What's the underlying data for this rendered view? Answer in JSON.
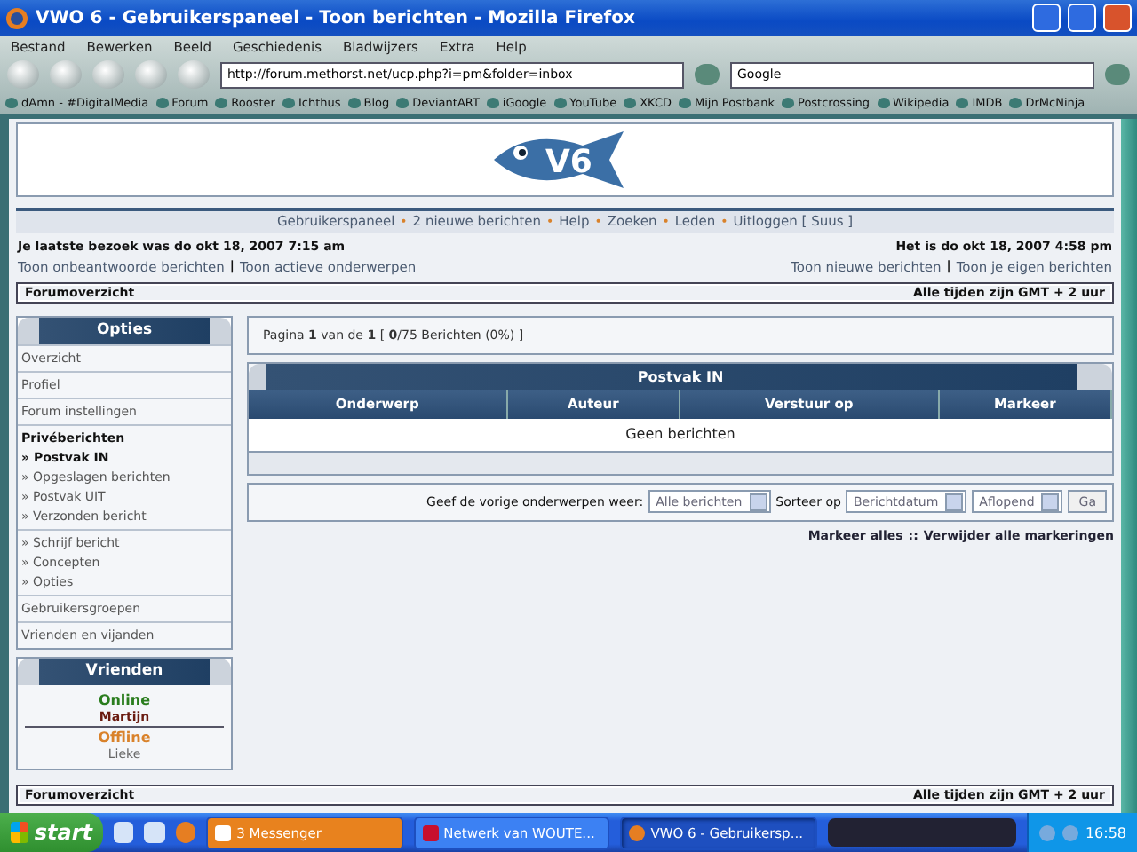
{
  "window": {
    "title": "VWO 6 - Gebruikerspaneel - Toon berichten - Mozilla Firefox"
  },
  "menu": [
    "Bestand",
    "Bewerken",
    "Beeld",
    "Geschiedenis",
    "Bladwijzers",
    "Extra",
    "Help"
  ],
  "toolbar": {
    "address": "http://forum.methorst.net/ucp.php?i=pm&folder=inbox",
    "search": "Google"
  },
  "bookmarks": [
    "dAmn - #DigitalMedia",
    "Forum",
    "Rooster",
    "Ichthus",
    "Blog",
    "DeviantART",
    "iGoogle",
    "YouTube",
    "XKCD",
    "Mijn Postbank",
    "Postcrossing",
    "Wikipedia",
    "IMDB",
    "DrMcNinja"
  ],
  "forum": {
    "logo_text": "V6",
    "nav": {
      "separator": "•",
      "links": [
        "Gebruikerspaneel",
        "2 nieuwe berichten",
        "Help",
        "Zoeken",
        "Leden",
        "Uitloggen [ Suus ]"
      ]
    },
    "last_visit": "Je laatste bezoek was do okt 18, 2007 7:15 am",
    "current_time": "Het is do okt 18, 2007 4:58 pm",
    "left_links": [
      "Toon onbeantwoorde berichten",
      "Toon actieve onderwerpen"
    ],
    "right_links": [
      "Toon nieuwe berichten",
      "Toon je eigen berichten"
    ],
    "link_divider": "|",
    "breadcrumb": {
      "label": "Forumoverzicht",
      "timezone": "Alle tijden zijn GMT + 2 uur"
    },
    "sidebar": {
      "title": "Opties",
      "groups": [
        [
          {
            "label": "Overzicht",
            "kind": "link",
            "selected": false
          }
        ],
        [
          {
            "label": "Profiel",
            "kind": "link",
            "selected": false
          }
        ],
        [
          {
            "label": "Forum instellingen",
            "kind": "link",
            "selected": false
          }
        ],
        [
          {
            "label": "Privéberichten",
            "kind": "header"
          },
          {
            "label": "» Postvak IN",
            "kind": "sub",
            "selected": true
          },
          {
            "label": "» Opgeslagen berichten",
            "kind": "sub",
            "selected": false
          },
          {
            "label": "» Postvak UIT",
            "kind": "sub",
            "selected": false
          },
          {
            "label": "» Verzonden bericht",
            "kind": "sub",
            "selected": false
          }
        ],
        [
          {
            "label": "» Schrijf bericht",
            "kind": "sub",
            "selected": false
          },
          {
            "label": "» Concepten",
            "kind": "sub",
            "selected": false
          },
          {
            "label": "» Opties",
            "kind": "sub",
            "selected": false
          }
        ],
        [
          {
            "label": "Gebruikersgroepen",
            "kind": "link",
            "selected": false
          }
        ],
        [
          {
            "label": "Vrienden en vijanden",
            "kind": "link",
            "selected": false
          }
        ]
      ]
    },
    "friends": {
      "title": "Vrienden",
      "groups": [
        {
          "label": "Online",
          "color": "#2a7d1e",
          "members": [
            "Martijn"
          ]
        },
        {
          "label": "Offline",
          "color": "#d9822b",
          "members": [
            "Lieke"
          ]
        }
      ]
    },
    "pagination": "Pagina **1** van de **1**  [ **0**/75 Berichten (0%) ]",
    "mailbox": {
      "title": "Postvak IN",
      "columns": [
        "Onderwerp",
        "Auteur",
        "Verstuur op",
        "Markeer"
      ],
      "empty": "Geen berichten"
    },
    "filter": {
      "label": "Geef de vorige onderwerpen weer:",
      "show": "Alle berichten",
      "sort_label": "Sorteer op",
      "sort": "Berichtdatum",
      "order": "Aflopend",
      "go": "Ga"
    },
    "mark": {
      "mark_all": "Markeer alles",
      "separator": "::",
      "unmark_all": "Verwijder alle markeringen"
    },
    "footer": {
      "label": "Forumoverzicht",
      "timezone": "Alle tijden zijn GMT + 2 uur"
    }
  },
  "taskbar": {
    "start": "start",
    "tasks": [
      {
        "label": "3 Messenger",
        "kind": "group",
        "selected": false
      },
      {
        "label": "Netwerk van WOUTE...",
        "kind": "mail",
        "selected": false
      },
      {
        "label": "VWO 6 - Gebruikersp...",
        "kind": "browser",
        "selected": true
      }
    ],
    "clock": "16:58"
  }
}
